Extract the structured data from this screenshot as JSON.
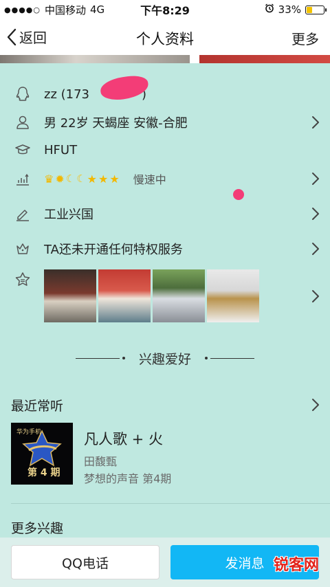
{
  "status_bar": {
    "carrier": "中国移动",
    "network": "4G",
    "time": "下午8:29",
    "battery_percent": "33%",
    "battery_level": 0.33
  },
  "nav": {
    "back_label": "返回",
    "title": "个人资料",
    "more_label": "更多"
  },
  "profile": {
    "name": "zz (173",
    "name_suffix": ")",
    "basic_info": "男 22岁 天蝎座 安徽-合肥",
    "school": "HFUT",
    "level_glyphs": [
      "crown",
      "sun",
      "moon",
      "moon",
      "star",
      "star",
      "star"
    ],
    "level_status": "慢速中",
    "signature": "工业兴国",
    "privilege": "TA还未开通任何特权服务"
  },
  "interests": {
    "section_label": "兴趣爱好",
    "recent_listen_label": "最近常听",
    "song_title": "凡人歌 + 火",
    "artist": "田馥甄",
    "album": "梦想的声音 第4期",
    "album_brand": "华为手机",
    "album_episode": "第 4 期",
    "more_interests_label": "更多兴趣"
  },
  "actions": {
    "call_label": "QQ电话",
    "message_label": "发消息",
    "watermark": "锐客网"
  },
  "colors": {
    "background": "#bfe8e0",
    "accent_blue": "#12b7f5",
    "redaction_pink": "#f33d77"
  }
}
